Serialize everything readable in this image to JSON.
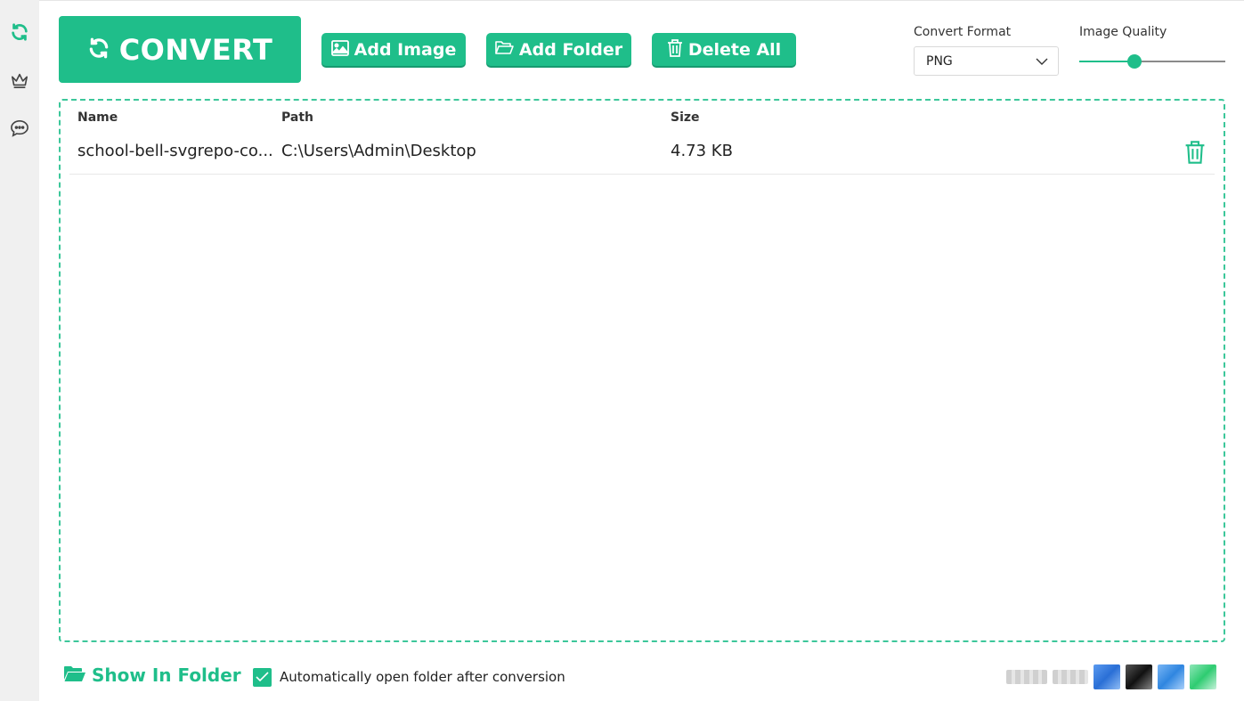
{
  "toolbar": {
    "convert_label": "CONVERT",
    "add_image_label": "Add Image",
    "add_folder_label": "Add Folder",
    "delete_all_label": "Delete All"
  },
  "settings": {
    "format_label": "Convert Format",
    "format_value": "PNG",
    "quality_label": "Image Quality",
    "quality_value": 0.38
  },
  "table": {
    "headers": [
      "Name",
      "Path",
      "Size"
    ],
    "rows": [
      {
        "name": "school-bell-svgrepo-co...",
        "path": "C:\\Users\\Admin\\Desktop",
        "size": "4.73 KB"
      }
    ]
  },
  "footer": {
    "show_in_folder_label": "Show In Folder",
    "auto_open_label": "Automatically open folder after conversion",
    "auto_open_checked": true
  },
  "colors": {
    "accent": "#1fbe8a",
    "sidebar": "#f0f0f0"
  }
}
